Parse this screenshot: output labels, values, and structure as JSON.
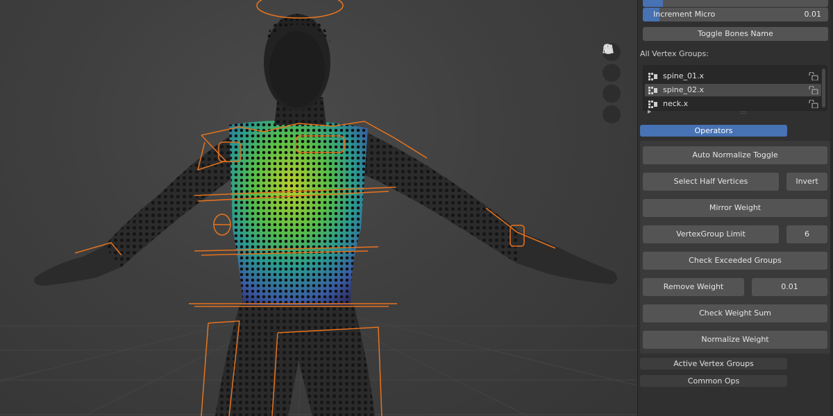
{
  "sliders": [
    {
      "label": "",
      "value": "",
      "fill": 0.11
    },
    {
      "label": "Increment Micro",
      "value": "0.01",
      "fill": 0.09
    }
  ],
  "toggle_bones_label": "Toggle Bones Name",
  "vertex_groups": {
    "title": "All Vertex Groups:",
    "items": [
      {
        "name": "spine_01.x",
        "selected": false
      },
      {
        "name": "spine_02.x",
        "selected": true
      },
      {
        "name": "neck.x",
        "selected": false
      }
    ]
  },
  "operators": {
    "header": "Operators",
    "auto_normalize": "Auto Normalize Toggle",
    "select_half": "Select Half Vertices",
    "invert": "Invert",
    "mirror_weight": "Mirror Weight",
    "vg_limit": "VertexGroup Limit",
    "vg_limit_value": "6",
    "check_exceeded": "Check Exceeded Groups",
    "remove_weight": "Remove Weight",
    "remove_weight_value": "0.01",
    "check_weight_sum": "Check Weight Sum",
    "normalize_weight": "Normalize Weight"
  },
  "panels": {
    "active_vertex_groups": "Active Vertex Groups",
    "common_ops": "Common Ops"
  },
  "colors": {
    "accent": "#4772b3",
    "bone_orange": "#e8741f",
    "panel_bg": "#303030",
    "button": "#545454"
  },
  "viewport_icons": [
    "zoom-icon",
    "hand-pan-icon",
    "camera-icon",
    "grid-ortho-icon"
  ]
}
